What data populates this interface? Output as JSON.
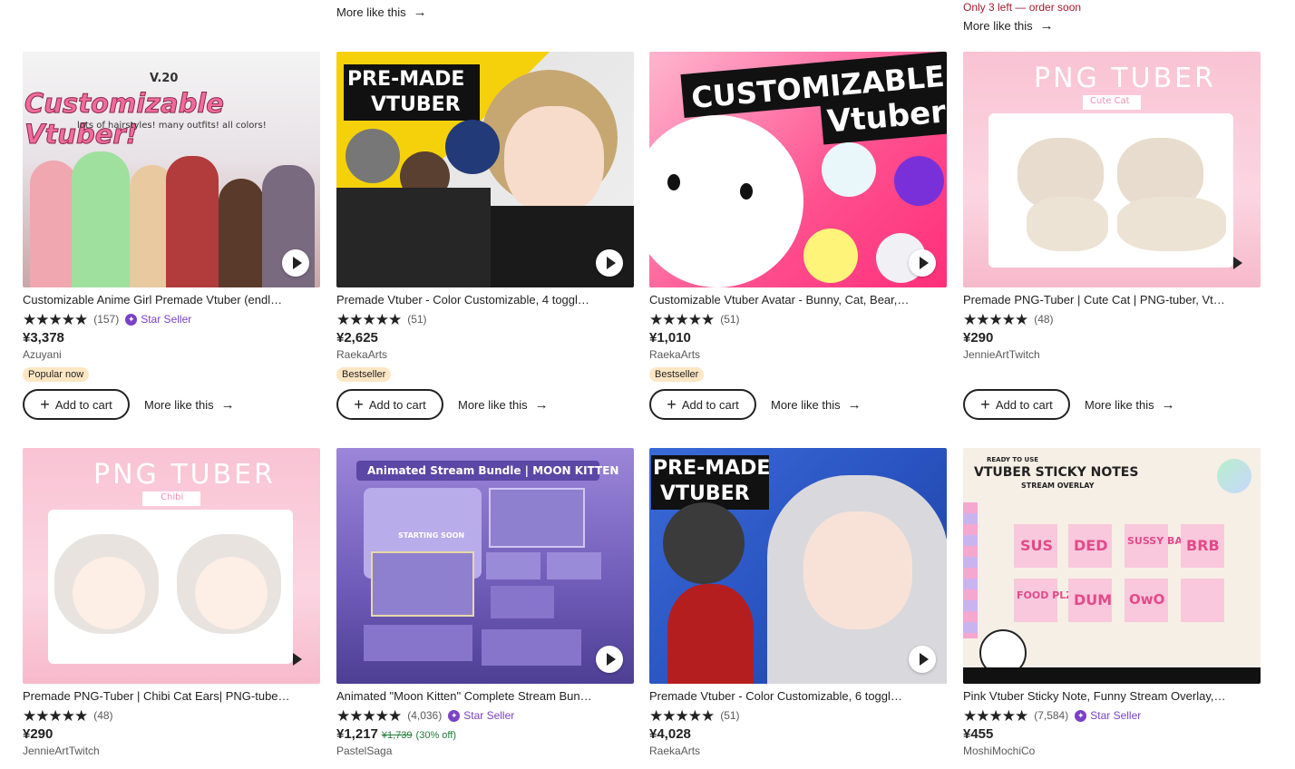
{
  "top": {
    "more_like_this": "More like this",
    "urgency": "Only 3 left — order soon",
    "arrow": "→"
  },
  "cards": [
    {
      "title": "Customizable Anime Girl Premade Vtuber (endl…",
      "stars": "★★★★★",
      "reviews": "(157)",
      "star_seller": "Star Seller",
      "price": "¥3,378",
      "shop": "Azuyani",
      "badge": "Popular now",
      "thumb_text": [
        "V.20",
        "Customizable Vtuber!",
        "lots of hairstyles! many outfits! all colors!"
      ]
    },
    {
      "title": "Premade Vtuber - Color Customizable, 4 toggl…",
      "stars": "★★★★★",
      "reviews": "(51)",
      "price": "¥2,625",
      "shop": "RaekaArts",
      "badge": "Bestseller",
      "thumb_text": [
        "PRE-MADE",
        "VTUBER"
      ]
    },
    {
      "title": "Customizable Vtuber Avatar - Bunny, Cat, Bear,…",
      "stars": "★★★★★",
      "reviews": "(51)",
      "price": "¥1,010",
      "shop": "RaekaArts",
      "badge": "Bestseller",
      "thumb_text": [
        "CUSTOMIZABLE",
        "Vtuber"
      ]
    },
    {
      "title": "Premade PNG-Tuber | Cute Cat | PNG-tuber, Vt…",
      "stars": "★★★★★",
      "reviews": "(48)",
      "price": "¥290",
      "shop": "JennieArtTwitch",
      "thumb_text": [
        "PNG TUBER",
        "Cute Cat"
      ]
    },
    {
      "title": "Premade PNG-Tuber | Chibi Cat Ears| PNG-tube…",
      "stars": "★★★★★",
      "reviews": "(48)",
      "price": "¥290",
      "shop": "JennieArtTwitch",
      "thumb_text": [
        "PNG TUBER",
        "Chibi"
      ]
    },
    {
      "title": "Animated \"Moon Kitten\" Complete Stream Bun…",
      "stars": "★★★★★",
      "reviews": "(4,036)",
      "star_seller": "Star Seller",
      "price": "¥1,217",
      "old_price": "¥1,739",
      "discount": "(30% off)",
      "shop": "PastelSaga",
      "thumb_text": [
        "Animated Stream Bundle | MOON KITTEN",
        "STARTING SOON"
      ]
    },
    {
      "title": "Premade Vtuber - Color Customizable, 6 toggl…",
      "stars": "★★★★★",
      "reviews": "(51)",
      "price": "¥4,028",
      "shop": "RaekaArts",
      "thumb_text": [
        "PRE-MADE",
        "VTUBER"
      ]
    },
    {
      "title": "Pink Vtuber Sticky Note, Funny Stream Overlay,…",
      "stars": "★★★★★",
      "reviews": "(7,584)",
      "star_seller": "Star Seller",
      "price": "¥455",
      "shop": "MoshiMochiCo",
      "thumb_text": [
        "READY TO USE",
        "VTUBER STICKY NOTES",
        "STREAM OVERLAY",
        "SUS",
        "DED",
        "SUSSY BAKA",
        "BRB",
        "FOOD PLZ",
        "DUM",
        "OwO"
      ]
    }
  ],
  "buttons": {
    "add_to_cart": "Add to cart",
    "more_like_this": "More like this",
    "plus": "+",
    "arrow": "→"
  },
  "colors": {
    "star_seller": "#7b41c7",
    "badge_bg": "#fde6c3",
    "urgency": "#a61a2e",
    "discount": "#1f7a38"
  }
}
